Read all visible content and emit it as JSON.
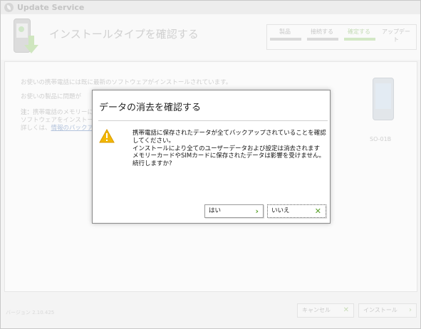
{
  "window": {
    "title": "Update Service"
  },
  "header": {
    "page_title": "インストールタイプを確認する",
    "steps": [
      {
        "label": "製品",
        "active": false
      },
      {
        "label": "接続する",
        "active": false
      },
      {
        "label": "確定する",
        "active": true
      },
      {
        "label": "アップデート",
        "active": false
      }
    ]
  },
  "content": {
    "line1": "お使いの携帯電話には既に最新のソフトウェアがインストールされています。",
    "line2": "お使いの製品に問題が",
    "note_prefix": "注：",
    "note_line1": "携帯電話のメモリーに",
    "note_line2": "ソフトウェアをインストール",
    "note_line3_prefix": "詳しくは、",
    "note_link": "情報のバックア",
    "device_label": "SO-01B"
  },
  "footer": {
    "version": "バージョン 2.10.425",
    "cancel_label": "キャンセル",
    "install_label": "インストール"
  },
  "dialog": {
    "title": "データの消去を確認する",
    "message_lines": [
      "携帯電話に保存されたデータが全てバックアップされていることを確認",
      "してください。",
      "インストールにより全てのユーザーデータおよび設定は消去されます",
      "メモリーカードやSIMカードに保存されたデータは影響を受けません。",
      "続行しますか?"
    ],
    "yes_label": "はい",
    "no_label": "いいえ"
  },
  "colors": {
    "accent_green": "#5aa02c",
    "warning_yellow": "#f2b705"
  }
}
